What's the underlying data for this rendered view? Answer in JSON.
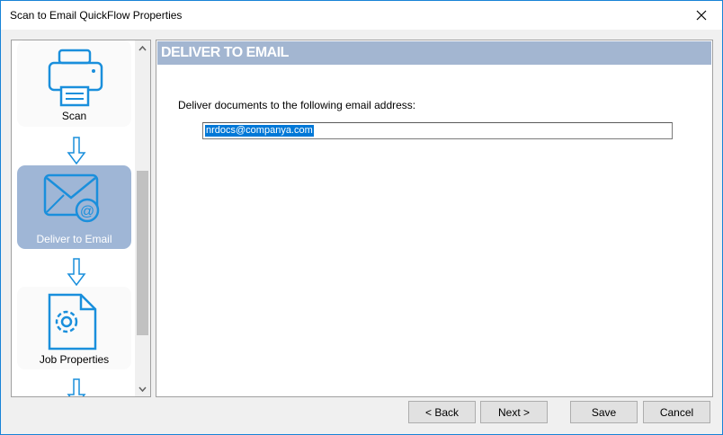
{
  "window": {
    "title": "Scan to Email QuickFlow Properties"
  },
  "nav": {
    "items": [
      {
        "label": "Scan",
        "icon": "printer-icon"
      },
      {
        "label": "Deliver to Email",
        "icon": "email-icon"
      },
      {
        "label": "Job Properties",
        "icon": "gear-document-icon"
      }
    ],
    "selected": "Deliver to Email"
  },
  "content": {
    "header": "DELIVER TO EMAIL",
    "prompt": "Deliver documents to the following email address:",
    "email_value": "nrdocs@companya.com"
  },
  "buttons": {
    "back": "< Back",
    "next": "Next >",
    "save": "Save",
    "cancel": "Cancel"
  },
  "colors": {
    "accent": "#1a8fdc",
    "selected_card": "#9fb6d6",
    "header_bg": "#a3b6d1",
    "selection": "#0078d7"
  }
}
